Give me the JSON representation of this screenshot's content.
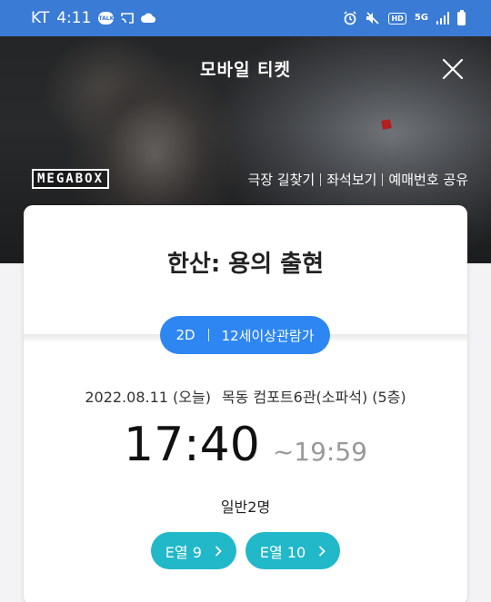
{
  "status_bar": {
    "carrier": "KT",
    "time": "4:11",
    "talk_label": "TALK",
    "hd_label": "HD",
    "network_label": "5G"
  },
  "header": {
    "title": "모바일 티켓",
    "logo_text": "MEGABOX",
    "links": [
      "극장 길찾기",
      "좌석보기",
      "예매번호 공유"
    ]
  },
  "ticket": {
    "movie_title": "한산: 용의 출현",
    "format": "2D",
    "rating": "12세이상관람가",
    "date": "2022.08.11 (오늘)",
    "theater": "목동 컴포트6관(소파석) (5층)",
    "start_time": "17:40",
    "end_time": "~19:59",
    "audience": "일반2명",
    "seats": [
      "E열 9",
      "E열 10"
    ]
  },
  "colors": {
    "status_bar": "#3a7bd5",
    "badge": "#2d86f2",
    "seat_chip": "#21b8c9"
  }
}
